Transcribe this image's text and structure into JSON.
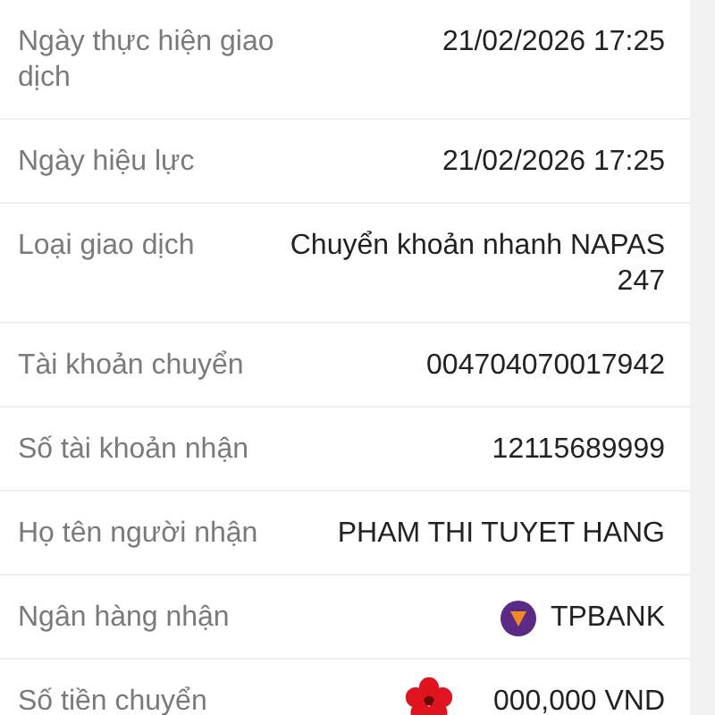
{
  "rows": [
    {
      "label": "Ngày thực hiện giao dịch",
      "value": "21/02/2026 17:25"
    },
    {
      "label": "Ngày hiệu lực",
      "value": "21/02/2026 17:25"
    },
    {
      "label": "Loại giao dịch",
      "value": "Chuyển khoản nhanh NAPAS 247"
    },
    {
      "label": "Tài khoản chuyển",
      "value": "004704070017942"
    },
    {
      "label": "Số tài khoản nhận",
      "value": "12115689999"
    },
    {
      "label": "Họ tên người nhận",
      "value": "PHAM THI TUYET HANG"
    },
    {
      "label": "Ngân hàng nhận",
      "value": "TPBANK",
      "kind": "bank"
    },
    {
      "label": "Số tiền chuyển",
      "value": "000,000 VND",
      "kind": "amount"
    }
  ]
}
